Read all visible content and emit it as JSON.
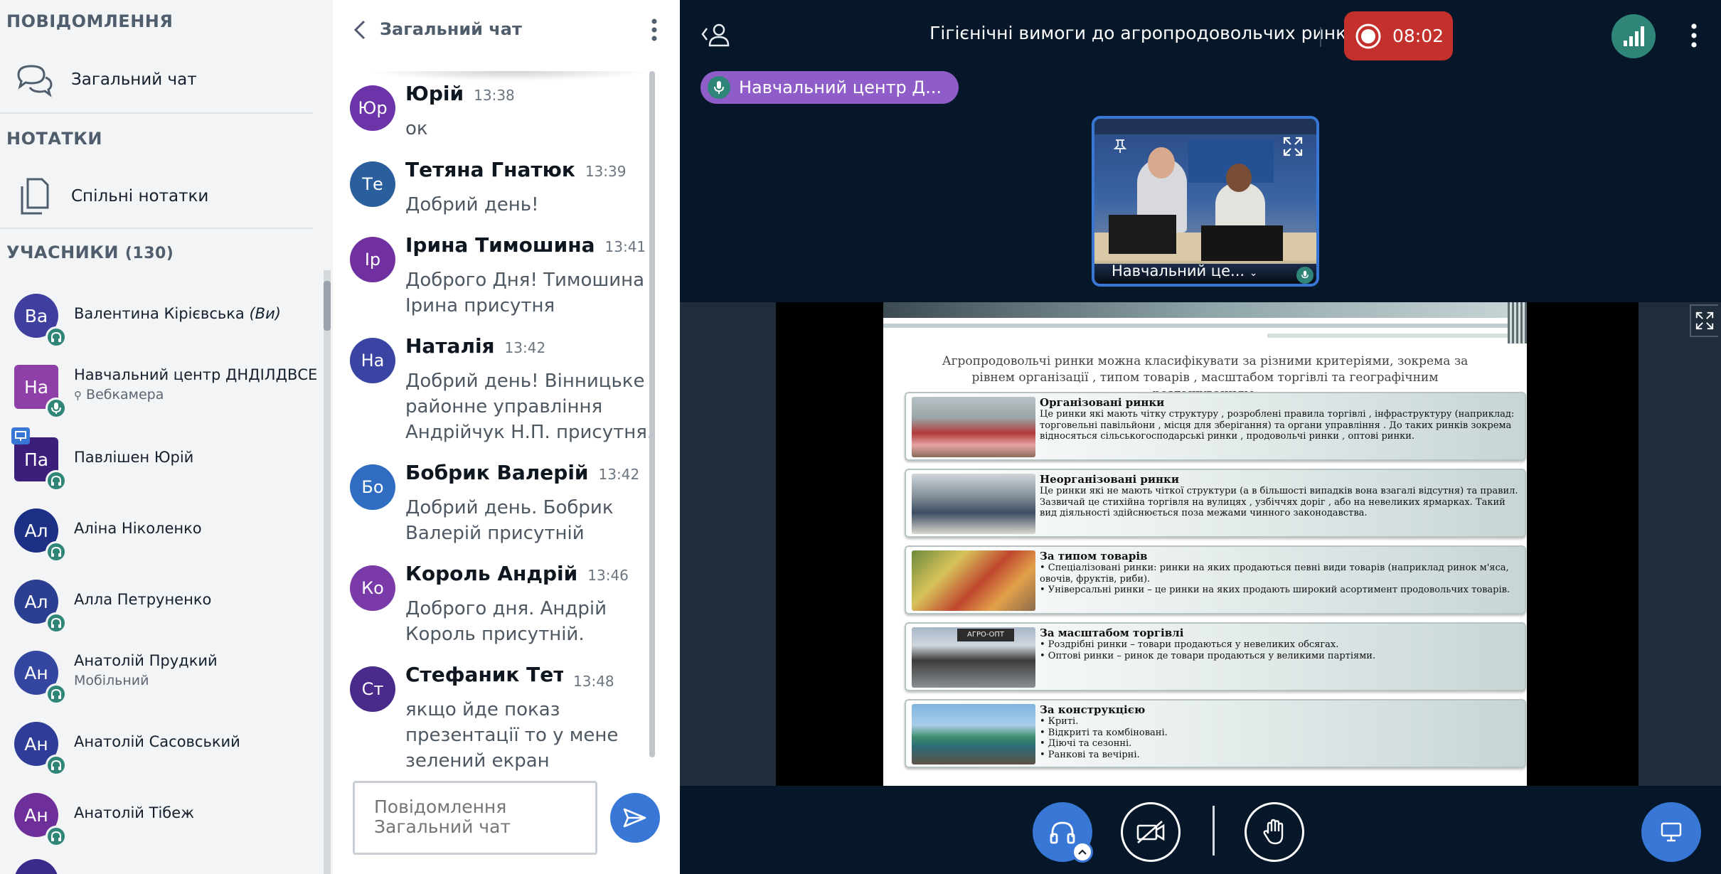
{
  "sidebar": {
    "messages_title": "ПОВІДОМЛЕННЯ",
    "public_chat_label": "Загальний чат",
    "notes_title": "НОТАТКИ",
    "shared_notes_label": "Спільні нотатки",
    "participants_title": "УЧАСНИКИ",
    "participants_count": "(130)",
    "users": [
      {
        "initials": "Ва",
        "name": "Валентина Кірієвська",
        "suffix": "(Ви)",
        "color": "#3f3f9f"
      },
      {
        "initials": "На",
        "name": "Навчальний центр ДНДІЛДВСЕ",
        "sub": "Вебкамера",
        "color": "#8e3fa8"
      },
      {
        "initials": "Па",
        "name": "Павлішен Юрій",
        "color": "#3b1f7a"
      },
      {
        "initials": "Ал",
        "name": "Аліна Ніколенко",
        "color": "#1e2f86"
      },
      {
        "initials": "Ал",
        "name": "Алла Петруненко",
        "color": "#2c3e92"
      },
      {
        "initials": "Ан",
        "name": "Анатолій Прудкий",
        "sub": "Мобільний",
        "color": "#3546a0"
      },
      {
        "initials": "Ан",
        "name": "Анатолій Сасовський",
        "color": "#2f3c98"
      },
      {
        "initials": "Ан",
        "name": "Анатолій Тібеж",
        "color": "#6f2f9a"
      }
    ]
  },
  "chat": {
    "title": "Загальний чат",
    "input_placeholder": "Повідомлення Загальний чат",
    "messages": [
      {
        "initials": "Юр",
        "name": "Юрій",
        "time": "13:38",
        "text": "ок",
        "color": "#6b34a8"
      },
      {
        "initials": "Те",
        "name": "Тетяна Гнатюк",
        "time": "13:39",
        "text": "Добрий день!",
        "color": "#2a5e9c"
      },
      {
        "initials": "Ір",
        "name": "Ірина Тимошина",
        "time": "13:41",
        "text": "Доброго Дня! Тимошина Ірина присутня",
        "color": "#7030a0"
      },
      {
        "initials": "На",
        "name": "Наталія",
        "time": "13:42",
        "text": "Добрий день! Вінницьке районне управління Андрійчук Н.П. присутня.",
        "color": "#3a44a2"
      },
      {
        "initials": "Бо",
        "name": "Бобрик Валерій",
        "time": "13:42",
        "text": "Добрий день. Бобрик Валерій присутній",
        "color": "#2f6cc2"
      },
      {
        "initials": "Ко",
        "name": "Король Андрій",
        "time": "13:46",
        "text": "Доброго дня. Андрій Король присутній.",
        "color": "#7a3aa8"
      },
      {
        "initials": "Ст",
        "name": "Стефаник Тет...",
        "time": "13:48",
        "text": "якщо йде показ презентації то у мене зелений екран",
        "color": "#4a2a8a"
      }
    ]
  },
  "main": {
    "meeting_title": "Гігієнічні вимоги до агропродовольчих ринків",
    "record_time": "08:02",
    "talker_name": "Навчальний центр Д...",
    "webcam_name": "Навчальний це...",
    "colors": {
      "accent": "#3877d5",
      "record": "#c4302b",
      "connection": "#2f8577"
    }
  },
  "slide": {
    "intro": "Агропродовольчі ринки можна класифікувати за різними критеріями, зокрема за рівнем організації , типом товарів , масштабом торгівлі та географічним розташуванням.",
    "cards": [
      {
        "title": "Організовані ринки",
        "body": "Це ринки які мають чітку структуру , розроблені правила торгівлі , інфраструктуру (наприклад: торговельні павільйони , місця для зберігання) та органи управління . До таких ринків зокрема відносяться сільськогосподарські ринки , продовольчі ринки , оптові ринки."
      },
      {
        "title": "Неорганізовані ринки",
        "body": "Це ринки які не мають  чіткої структури (а в більшості випадків вона взагалі відсутня) та правил. Зазвичай це стихійна торгівля на вулицях , узбіччях доріг , або на невеликих ярмарках. Такий вид діяльності здійснюється поза межами чинного законодавства."
      },
      {
        "title": "За типом товарів",
        "body": "• Спеціалізовані ринки: ринки на яких продаються певні види товарів (наприклад ринок м'яса, овочів, фруктів, риби).\n• Універсальні ринки – це ринки на яких продають широкий асортимент продовольчих товарів."
      },
      {
        "title": "За масштабом торгівлі",
        "sign": "АГРО-ОПТ",
        "body": "• Роздрібні ринки – товари продаються у невеликих обсягах.\n• Оптові ринки – ринок де товари продаються у великими партіями."
      },
      {
        "title": "За конструкцією",
        "body": "• Криті.\n• Відкриті та комбіновані.\n• Діючі та сезонні.\n• Ранкові та вечірні."
      }
    ]
  }
}
